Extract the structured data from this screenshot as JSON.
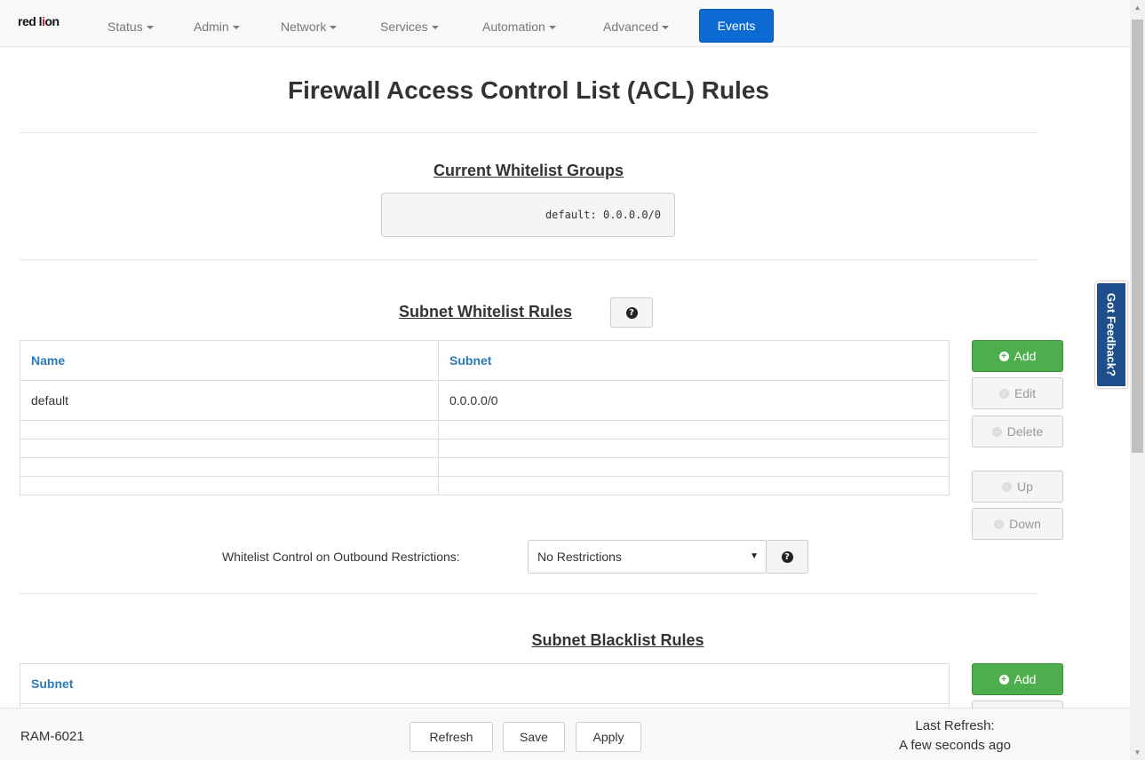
{
  "nav": {
    "logo_a": "red l",
    "logo_b": "i",
    "logo_c": "on",
    "items": [
      "Status",
      "Admin",
      "Network",
      "Services",
      "Automation",
      "Advanced"
    ],
    "events": "Events"
  },
  "page": {
    "title": "Firewall Access Control List (ACL) Rules"
  },
  "groups": {
    "title": "Current Whitelist Groups",
    "value": "default: 0.0.0.0/0"
  },
  "whitelist": {
    "title": "Subnet Whitelist Rules",
    "columns": [
      "Name",
      "Subnet"
    ],
    "rows": [
      [
        "default",
        "0.0.0.0/0"
      ]
    ],
    "buttons": {
      "add": "Add",
      "edit": "Edit",
      "delete": "Delete",
      "up": "Up",
      "down": "Down"
    }
  },
  "outbound": {
    "label": "Whitelist Control on Outbound Restrictions:",
    "selected": "No Restrictions"
  },
  "blacklist": {
    "title": "Subnet Blacklist Rules",
    "columns": [
      "Subnet"
    ],
    "buttons": {
      "add": "Add"
    }
  },
  "feedback": "Got Feedback?",
  "footer": {
    "device": "RAM-6021",
    "refresh": "Refresh",
    "save": "Save",
    "apply": "Apply",
    "last_refresh_label": "Last Refresh:",
    "last_refresh_value": "A few seconds ago"
  }
}
